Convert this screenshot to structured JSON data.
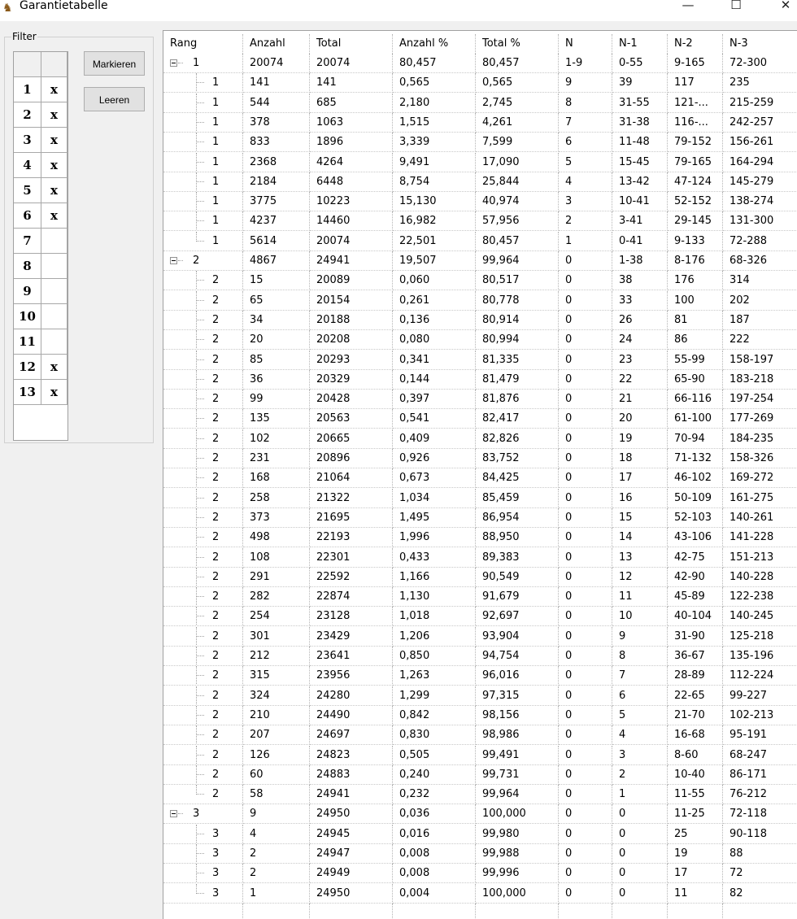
{
  "window": {
    "title": "Garantietabelle",
    "min_glyph": "—",
    "max_glyph": "☐",
    "close_glyph": "✕"
  },
  "filter": {
    "label": "Filter",
    "rows": [
      {
        "num": "1",
        "mark": "x"
      },
      {
        "num": "2",
        "mark": "x"
      },
      {
        "num": "3",
        "mark": "x"
      },
      {
        "num": "4",
        "mark": "x"
      },
      {
        "num": "5",
        "mark": "x"
      },
      {
        "num": "6",
        "mark": "x"
      },
      {
        "num": "7",
        "mark": ""
      },
      {
        "num": "8",
        "mark": ""
      },
      {
        "num": "9",
        "mark": ""
      },
      {
        "num": "10",
        "mark": ""
      },
      {
        "num": "11",
        "mark": ""
      },
      {
        "num": "12",
        "mark": "x"
      },
      {
        "num": "13",
        "mark": "x"
      }
    ]
  },
  "buttons": {
    "mark": "Markieren",
    "clear": "Leeren"
  },
  "table": {
    "columns": [
      "Rang",
      "Anzahl",
      "Total",
      "Anzahl %",
      "Total %",
      "N",
      "N-1",
      "N-2",
      "N-3"
    ],
    "rows": [
      {
        "level": 0,
        "cells": [
          "1",
          "20074",
          "20074",
          "80,457",
          "80,457",
          "1-9",
          "0-55",
          "9-165",
          "72-300"
        ]
      },
      {
        "level": 1,
        "cells": [
          "1",
          "141",
          "141",
          "0,565",
          "0,565",
          "9",
          "39",
          "117",
          "235"
        ]
      },
      {
        "level": 1,
        "cells": [
          "1",
          "544",
          "685",
          "2,180",
          "2,745",
          "8",
          "31-55",
          "121-...",
          "215-259"
        ]
      },
      {
        "level": 1,
        "cells": [
          "1",
          "378",
          "1063",
          "1,515",
          "4,261",
          "7",
          "31-38",
          "116-...",
          "242-257"
        ]
      },
      {
        "level": 1,
        "cells": [
          "1",
          "833",
          "1896",
          "3,339",
          "7,599",
          "6",
          "11-48",
          "79-152",
          "156-261"
        ]
      },
      {
        "level": 1,
        "cells": [
          "1",
          "2368",
          "4264",
          "9,491",
          "17,090",
          "5",
          "15-45",
          "79-165",
          "164-294"
        ]
      },
      {
        "level": 1,
        "cells": [
          "1",
          "2184",
          "6448",
          "8,754",
          "25,844",
          "4",
          "13-42",
          "47-124",
          "145-279"
        ]
      },
      {
        "level": 1,
        "cells": [
          "1",
          "3775",
          "10223",
          "15,130",
          "40,974",
          "3",
          "10-41",
          "52-152",
          "138-274"
        ]
      },
      {
        "level": 1,
        "cells": [
          "1",
          "4237",
          "14460",
          "16,982",
          "57,956",
          "2",
          "3-41",
          "29-145",
          "131-300"
        ]
      },
      {
        "level": 1,
        "cells": [
          "1",
          "5614",
          "20074",
          "22,501",
          "80,457",
          "1",
          "0-41",
          "9-133",
          "72-288"
        ]
      },
      {
        "level": 0,
        "cells": [
          "2",
          "4867",
          "24941",
          "19,507",
          "99,964",
          "0",
          "1-38",
          "8-176",
          "68-326"
        ]
      },
      {
        "level": 1,
        "cells": [
          "2",
          "15",
          "20089",
          "0,060",
          "80,517",
          "0",
          "38",
          "176",
          "314"
        ]
      },
      {
        "level": 1,
        "cells": [
          "2",
          "65",
          "20154",
          "0,261",
          "80,778",
          "0",
          "33",
          "100",
          "202"
        ]
      },
      {
        "level": 1,
        "cells": [
          "2",
          "34",
          "20188",
          "0,136",
          "80,914",
          "0",
          "26",
          "81",
          "187"
        ]
      },
      {
        "level": 1,
        "cells": [
          "2",
          "20",
          "20208",
          "0,080",
          "80,994",
          "0",
          "24",
          "86",
          "222"
        ]
      },
      {
        "level": 1,
        "cells": [
          "2",
          "85",
          "20293",
          "0,341",
          "81,335",
          "0",
          "23",
          "55-99",
          "158-197"
        ]
      },
      {
        "level": 1,
        "cells": [
          "2",
          "36",
          "20329",
          "0,144",
          "81,479",
          "0",
          "22",
          "65-90",
          "183-218"
        ]
      },
      {
        "level": 1,
        "cells": [
          "2",
          "99",
          "20428",
          "0,397",
          "81,876",
          "0",
          "21",
          "66-116",
          "197-254"
        ]
      },
      {
        "level": 1,
        "cells": [
          "2",
          "135",
          "20563",
          "0,541",
          "82,417",
          "0",
          "20",
          "61-100",
          "177-269"
        ]
      },
      {
        "level": 1,
        "cells": [
          "2",
          "102",
          "20665",
          "0,409",
          "82,826",
          "0",
          "19",
          "70-94",
          "184-235"
        ]
      },
      {
        "level": 1,
        "cells": [
          "2",
          "231",
          "20896",
          "0,926",
          "83,752",
          "0",
          "18",
          "71-132",
          "158-326"
        ]
      },
      {
        "level": 1,
        "cells": [
          "2",
          "168",
          "21064",
          "0,673",
          "84,425",
          "0",
          "17",
          "46-102",
          "169-272"
        ]
      },
      {
        "level": 1,
        "cells": [
          "2",
          "258",
          "21322",
          "1,034",
          "85,459",
          "0",
          "16",
          "50-109",
          "161-275"
        ]
      },
      {
        "level": 1,
        "cells": [
          "2",
          "373",
          "21695",
          "1,495",
          "86,954",
          "0",
          "15",
          "52-103",
          "140-261"
        ]
      },
      {
        "level": 1,
        "cells": [
          "2",
          "498",
          "22193",
          "1,996",
          "88,950",
          "0",
          "14",
          "43-106",
          "141-228"
        ]
      },
      {
        "level": 1,
        "cells": [
          "2",
          "108",
          "22301",
          "0,433",
          "89,383",
          "0",
          "13",
          "42-75",
          "151-213"
        ]
      },
      {
        "level": 1,
        "cells": [
          "2",
          "291",
          "22592",
          "1,166",
          "90,549",
          "0",
          "12",
          "42-90",
          "140-228"
        ]
      },
      {
        "level": 1,
        "cells": [
          "2",
          "282",
          "22874",
          "1,130",
          "91,679",
          "0",
          "11",
          "45-89",
          "122-238"
        ]
      },
      {
        "level": 1,
        "cells": [
          "2",
          "254",
          "23128",
          "1,018",
          "92,697",
          "0",
          "10",
          "40-104",
          "140-245"
        ]
      },
      {
        "level": 1,
        "cells": [
          "2",
          "301",
          "23429",
          "1,206",
          "93,904",
          "0",
          "9",
          "31-90",
          "125-218"
        ]
      },
      {
        "level": 1,
        "cells": [
          "2",
          "212",
          "23641",
          "0,850",
          "94,754",
          "0",
          "8",
          "36-67",
          "135-196"
        ]
      },
      {
        "level": 1,
        "cells": [
          "2",
          "315",
          "23956",
          "1,263",
          "96,016",
          "0",
          "7",
          "28-89",
          "112-224"
        ]
      },
      {
        "level": 1,
        "cells": [
          "2",
          "324",
          "24280",
          "1,299",
          "97,315",
          "0",
          "6",
          "22-65",
          "99-227"
        ]
      },
      {
        "level": 1,
        "cells": [
          "2",
          "210",
          "24490",
          "0,842",
          "98,156",
          "0",
          "5",
          "21-70",
          "102-213"
        ]
      },
      {
        "level": 1,
        "cells": [
          "2",
          "207",
          "24697",
          "0,830",
          "98,986",
          "0",
          "4",
          "16-68",
          "95-191"
        ]
      },
      {
        "level": 1,
        "cells": [
          "2",
          "126",
          "24823",
          "0,505",
          "99,491",
          "0",
          "3",
          "8-60",
          "68-247"
        ]
      },
      {
        "level": 1,
        "cells": [
          "2",
          "60",
          "24883",
          "0,240",
          "99,731",
          "0",
          "2",
          "10-40",
          "86-171"
        ]
      },
      {
        "level": 1,
        "cells": [
          "2",
          "58",
          "24941",
          "0,232",
          "99,964",
          "0",
          "1",
          "11-55",
          "76-212"
        ]
      },
      {
        "level": 0,
        "cells": [
          "3",
          "9",
          "24950",
          "0,036",
          "100,000",
          "0",
          "0",
          "11-25",
          "72-118"
        ]
      },
      {
        "level": 1,
        "cells": [
          "3",
          "4",
          "24945",
          "0,016",
          "99,980",
          "0",
          "0",
          "25",
          "90-118"
        ]
      },
      {
        "level": 1,
        "cells": [
          "3",
          "2",
          "24947",
          "0,008",
          "99,988",
          "0",
          "0",
          "19",
          "88"
        ]
      },
      {
        "level": 1,
        "cells": [
          "3",
          "2",
          "24949",
          "0,008",
          "99,996",
          "0",
          "0",
          "17",
          "72"
        ]
      },
      {
        "level": 1,
        "cells": [
          "3",
          "1",
          "24950",
          "0,004",
          "100,000",
          "0",
          "0",
          "11",
          "82"
        ]
      }
    ]
  }
}
